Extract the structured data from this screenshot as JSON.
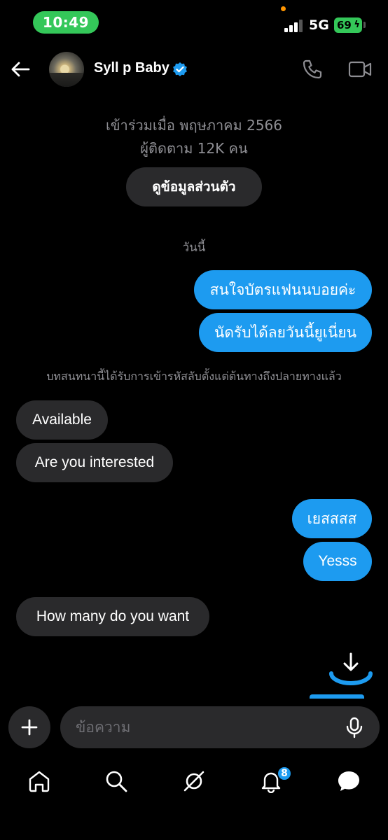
{
  "status_bar": {
    "time": "10:49",
    "network": "5G",
    "battery": "69"
  },
  "header": {
    "name": "Syll p Baby"
  },
  "profile": {
    "joined": "เข้าร่วมเมื่อ พฤษภาคม 2566",
    "followers": "ผู้ติดตาม 12K คน",
    "view_profile_label": "ดูข้อมูลส่วนตัว"
  },
  "today_label": "วันนี้",
  "encryption_notice": "บทสนทนานี้ได้รับการเข้ารหัสลับตั้งแต่ต้นทางถึงปลายทางแล้ว",
  "messages": [
    {
      "text": "สนใจบัตรแฟนนบอยค่ะ",
      "direction": "outgoing"
    },
    {
      "text": "นัดรับได้ลยวันนี้ยูเนี่ยน",
      "direction": "outgoing"
    },
    {
      "text": "Available",
      "direction": "incoming"
    },
    {
      "text": "Are you interested",
      "direction": "incoming"
    },
    {
      "text": "เยสสสส",
      "direction": "outgoing"
    },
    {
      "text": "Yesss",
      "direction": "outgoing"
    },
    {
      "text": "How many do you want",
      "direction": "incoming"
    }
  ],
  "composer": {
    "placeholder": "ข้อความ"
  },
  "nav": {
    "notifications_badge": "8"
  },
  "colors": {
    "accent": "#1d9bf0",
    "incoming_bubble": "#2a2a2c",
    "time_pill": "#34c759"
  }
}
